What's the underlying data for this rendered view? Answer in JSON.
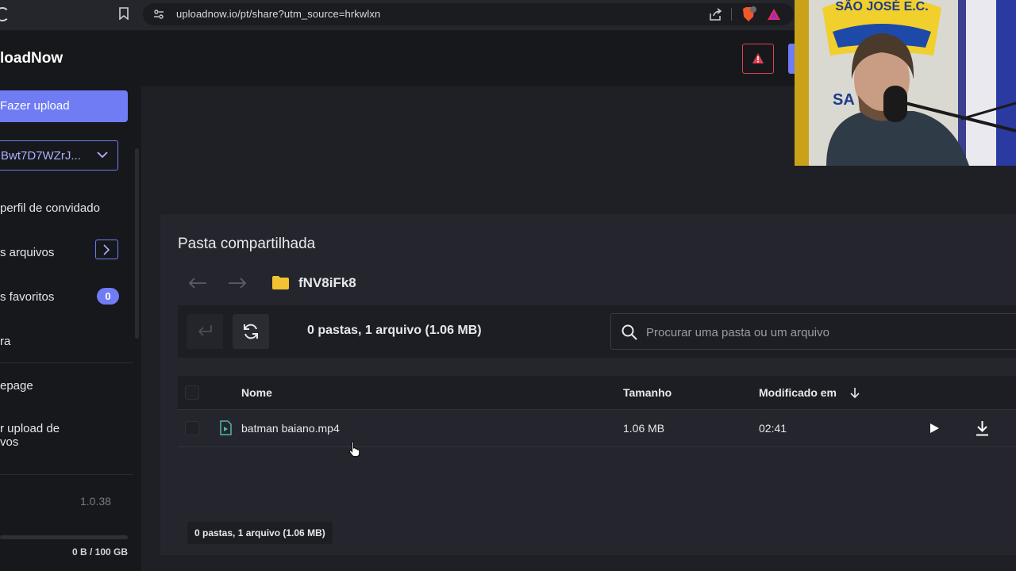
{
  "browser": {
    "url": "uploadnow.io/pt/share?utm_source=hrkwlxn",
    "brave_count": "2"
  },
  "sidebar": {
    "logo": "loadNow",
    "upload_button": "Fazer upload",
    "user_select": "Bwt7D7WZrJ...",
    "items": [
      {
        "label": "perfil de convidado"
      },
      {
        "label": "s arquivos"
      },
      {
        "label": "s favoritos"
      },
      {
        "label": "ra"
      },
      {
        "label": "epage"
      },
      {
        "label": "r upload de"
      },
      {
        "label": "vos"
      }
    ],
    "favorites_count": "0",
    "version": "1.0.38",
    "storage_used_fraction": 0,
    "storage": "0 B / 100 GB"
  },
  "panel": {
    "title": "Pasta compartilhada",
    "folder_name": "fNV8iFk8",
    "summary": "0 pastas, 1 arquivo (1.06 MB)",
    "search_placeholder": "Procurar uma pasta ou um arquivo",
    "columns": {
      "name": "Nome",
      "size": "Tamanho",
      "modified": "Modificado em"
    },
    "files": [
      {
        "name": "batman baiano.mp4",
        "size": "1.06 MB",
        "modified": "02:41"
      }
    ],
    "footer_summary": "0 pastas, 1 arquivo (1.06 MB)"
  },
  "webcam": {
    "banner_text": "SÃO JOSÉ E.C.",
    "shirt_text": "SA"
  },
  "colors": {
    "accent": "#6f7cf4",
    "alert": "#e04050",
    "folder": "#f1c232",
    "file_icon": "#4fb8a0"
  }
}
